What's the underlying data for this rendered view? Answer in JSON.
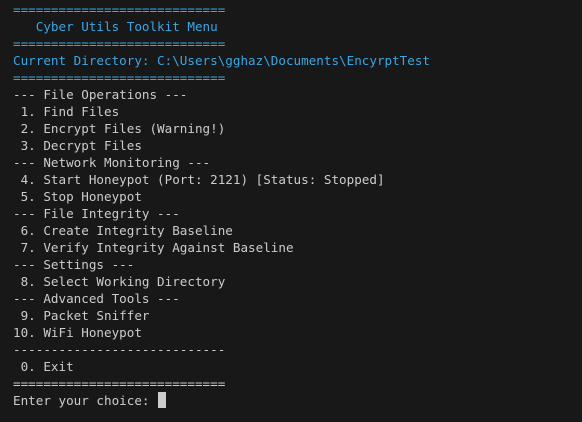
{
  "colors": {
    "background": "#181818",
    "header_text": "#3aa6e6",
    "body_text": "#cccccc"
  },
  "header": {
    "rule_top": "============================",
    "title": "   Cyber Utils Toolkit Menu",
    "rule_mid": "============================",
    "current_directory": "Current Directory: C:\\Users\\gghaz\\Documents\\EncyrptTest",
    "rule_bottom": "============================"
  },
  "menu": {
    "file_ops_header": "--- File Operations ---",
    "item_1": " 1. Find Files",
    "item_2": " 2. Encrypt Files (Warning!)",
    "item_3": " 3. Decrypt Files",
    "network_header": "--- Network Monitoring ---",
    "item_4": " 4. Start Honeypot (Port: 2121) [Status: Stopped]",
    "item_5": " 5. Stop Honeypot",
    "integrity_header": "--- File Integrity ---",
    "item_6": " 6. Create Integrity Baseline",
    "item_7": " 7. Verify Integrity Against Baseline",
    "settings_header": "--- Settings ---",
    "item_8": " 8. Select Working Directory",
    "advanced_header": "--- Advanced Tools ---",
    "item_9": " 9. Packet Sniffer",
    "item_10": "10. WiFi Honeypot",
    "separator": "----------------------------",
    "item_0": " 0. Exit",
    "rule_end": "============================"
  },
  "prompt": {
    "text": "Enter your choice: "
  }
}
